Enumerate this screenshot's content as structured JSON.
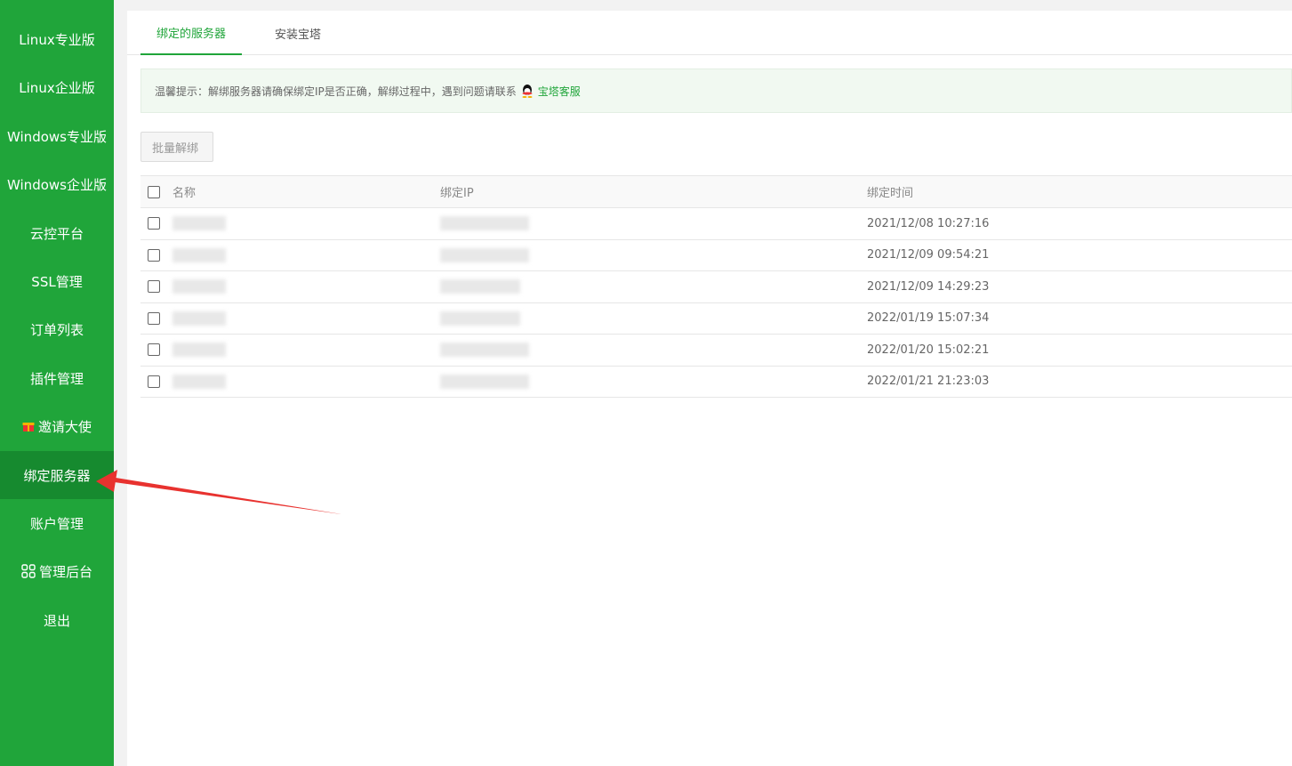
{
  "sidebar": {
    "items": [
      {
        "label": "Linux专业版"
      },
      {
        "label": "Linux企业版"
      },
      {
        "label": "Windows专业版"
      },
      {
        "label": "Windows企业版"
      },
      {
        "label": "云控平台"
      },
      {
        "label": "SSL管理"
      },
      {
        "label": "订单列表"
      },
      {
        "label": "插件管理"
      },
      {
        "label": "邀请大使",
        "icon": "gift-icon"
      },
      {
        "label": "绑定服务器",
        "active": true
      },
      {
        "label": "账户管理"
      },
      {
        "label": "管理后台",
        "icon": "grid-icon"
      },
      {
        "label": "退出"
      }
    ]
  },
  "tabs": [
    {
      "label": "绑定的服务器",
      "active": true
    },
    {
      "label": "安装宝塔"
    }
  ],
  "tip": {
    "text": "温馨提示：解绑服务器请确保绑定IP是否正确，解绑过程中，遇到问题请联系",
    "link": "宝塔客服"
  },
  "batch_button": "批量解绑",
  "table": {
    "headers": [
      "名称",
      "绑定IP",
      "绑定时间"
    ],
    "rows": [
      {
        "time": "2021/12/08 10:27:16"
      },
      {
        "time": "2021/12/09 09:54:21"
      },
      {
        "time": "2021/12/09 14:29:23"
      },
      {
        "time": "2022/01/19 15:07:34"
      },
      {
        "time": "2022/01/20 15:02:21"
      },
      {
        "time": "2022/01/21 21:23:03"
      }
    ]
  },
  "colors": {
    "brand": "#20a53a",
    "active_item": "#168a2f",
    "arrow": "#e8322f"
  }
}
